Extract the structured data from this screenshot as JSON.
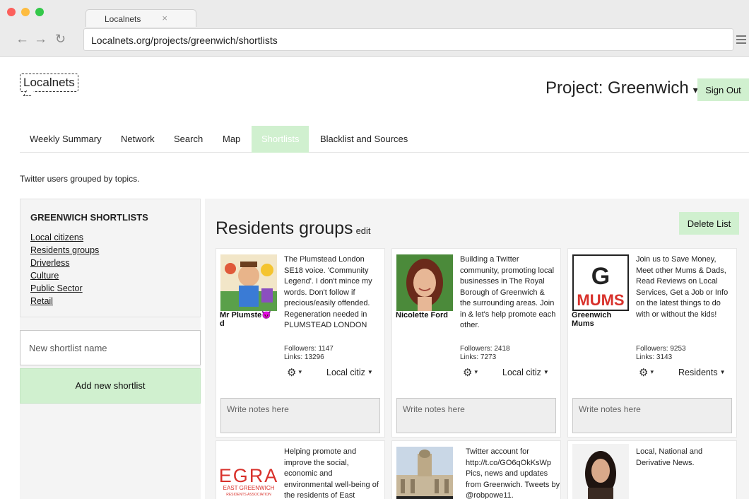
{
  "browser": {
    "tab_title": "Localnets",
    "url": "Localnets.org/projects/greenwich/shortlists",
    "traffic_lights": [
      "#fc605c",
      "#fdbc40",
      "#34c84a"
    ]
  },
  "header": {
    "logo": "Localnets",
    "project_label": "Project: Greenwich",
    "sign_out": "Sign Out"
  },
  "nav": {
    "items": [
      "Weekly Summary",
      "Network",
      "Search",
      "Map",
      "Shortlists",
      "Blacklist and Sources"
    ],
    "active": "Shortlists"
  },
  "subtitle": "Twitter users grouped by topics.",
  "sidebar": {
    "heading": "GREENWICH SHORTLISTS",
    "lists": [
      "Local citizens",
      "Residents groups",
      "Driverless",
      "Culture",
      "Public Sector",
      "Retail"
    ],
    "new_placeholder": "New shortlist name",
    "add_button": "Add new shortlist"
  },
  "main": {
    "list_title": "Residents groups",
    "edit_label": "edit",
    "delete_button": "Delete List",
    "notes_placeholder": "Write notes here",
    "cards": [
      {
        "name": "Mr Plumste😈 d",
        "bio": "The Plumstead London SE18 voice. 'Community Legend'. I don't mince my words. Don't follow if precious/easily offended. Regeneration needed in PLUMSTEAD LONDON",
        "followers": "Followers: 1147",
        "links": "Links: 13296",
        "category": "Local citiz",
        "avatar_icon": "cartoon-avatar"
      },
      {
        "name": "Nicolette Ford",
        "bio": "Building a Twitter community, promoting local businesses in The Royal Borough of Greenwich & the surrounding areas. Join in & let's help promote each other.",
        "followers": "Followers: 2418",
        "links": "Links: 7273",
        "category": "Local citiz",
        "avatar_icon": "photo-avatar"
      },
      {
        "name": "Greenwich Mums",
        "bio": "Join us to Save Money, Meet other Mums & Dads, Read Reviews on Local Services, Get a Job or Info on the latest things to do with or without the kids!",
        "followers": "Followers: 9253",
        "links": "Links: 3143",
        "category": "Residents",
        "avatar_icon": "g-mums-logo",
        "logo_text": [
          "G",
          "MUMS"
        ]
      },
      {
        "bio": "Helping promote and improve the social, economic and environmental well-being of the residents of East Greenwich, London.",
        "avatar_icon": "egra-logo",
        "logo_text": [
          "EGRA",
          "EAST GREENWICH",
          "RESIDENTS ASSOCIATION"
        ]
      },
      {
        "bio": "Twitter account for http://t.co/GO6qOkKsWp Pics, news and updates from Greenwich. Tweets by @robpowe11.",
        "avatar_icon": "building-photo"
      },
      {
        "bio": "Local, National and Derivative News.",
        "avatar_icon": "woman-photo"
      }
    ]
  }
}
